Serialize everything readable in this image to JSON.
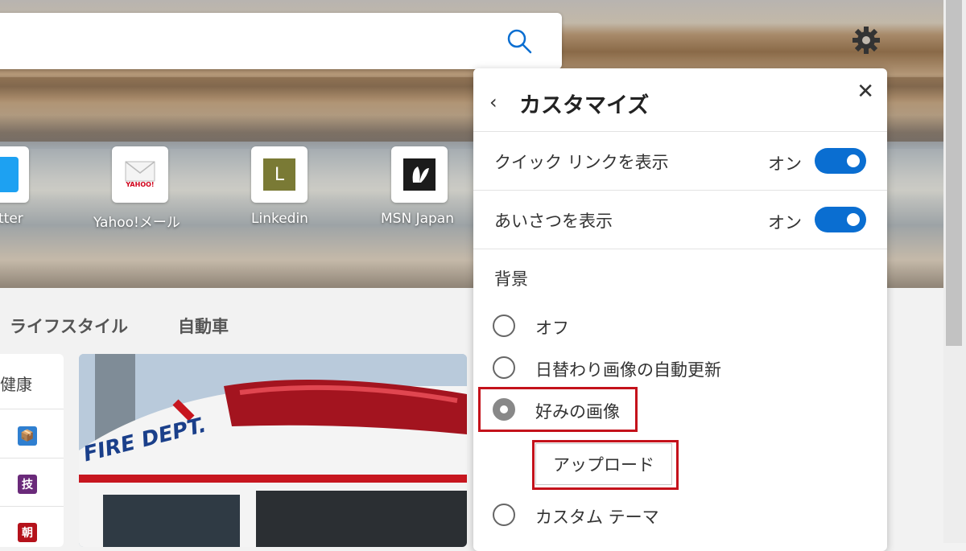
{
  "search": {
    "placeholder": ""
  },
  "quick_links": [
    {
      "label": "tter",
      "icon": "twitter-icon"
    },
    {
      "label": "Yahoo!メール",
      "icon": "yahoo-mail-icon",
      "logo_text": "YAHOO!"
    },
    {
      "label": "Linkedin",
      "icon": "linkedin-icon",
      "letter": "L"
    },
    {
      "label": "MSN Japan",
      "icon": "msn-icon"
    }
  ],
  "nav": {
    "items": [
      "ライフスタイル",
      "自動車"
    ]
  },
  "left_card": {
    "label": "健康",
    "icons": [
      "📦",
      "技",
      "朝"
    ]
  },
  "news_image": {
    "text": "FIRE DEPT."
  },
  "panel": {
    "back_icon": "chevron-left-icon",
    "title": "カスタマイズ",
    "close_icon": "close-icon",
    "toggles": [
      {
        "label": "クイック リンクを表示",
        "state": "オン",
        "on": true
      },
      {
        "label": "あいさつを表示",
        "state": "オン",
        "on": true
      }
    ],
    "background_section": "背景",
    "background_options": [
      {
        "label": "オフ",
        "selected": false
      },
      {
        "label": "日替わり画像の自動更新",
        "selected": false
      },
      {
        "label": "好みの画像",
        "selected": true
      },
      {
        "label": "カスタム テーマ",
        "selected": false
      }
    ],
    "upload_label": "アップロード"
  },
  "colors": {
    "accent": "#0a6ed1",
    "highlight": "#c4121b"
  }
}
